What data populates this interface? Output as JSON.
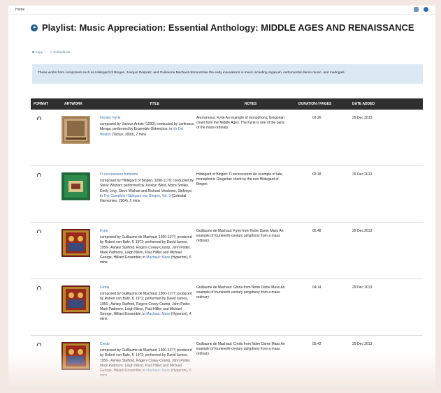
{
  "nav": {
    "home": "Home"
  },
  "page": {
    "title": "Playlist:  Music Appreciation: Essential Anthology: MIDDLE AGES AND RENAISSANCE",
    "copy": "Copy",
    "embed": "Embed/Link",
    "description": "These works from composers such as Hildegard of Bingen, Josquin Desprez, and Guillaume Machaut demonstrate the early innovations in music including organum, instrumental dance music, and madrigals."
  },
  "table": {
    "headers": [
      "FORMAT",
      "ARTWORK",
      "TITLE",
      "NOTES",
      "DURATION / PAGES",
      "DATE ADDED"
    ],
    "rows": [
      {
        "title": "Introito: Kyrie",
        "details": "composed by Various Artists (1200); conducted by Lanfranco Menga; performed by Ensemble Oktoechos; in ",
        "album": "Vir Dei Beatus",
        "tail": " (Tactus, 2000), 2 mins",
        "notes": "Anonymous: Kyrie An example of monophonic Gregorian chant from the Middle Ages. The Kyrie is one of the parts of the mass ordinary.",
        "duration": "02:26",
        "date": "29 Dec 2013"
      },
      {
        "title": "O successores fortissimi",
        "details": "composed by Hildegard of Bingen, 1098-1179; conducted by Steve Wishart; performed by Jocelyn West, Moira Smiley, Emily Levy, Steve Wishart and Richard Vendome, Sinfonye; in ",
        "album": "The Complete Hildegard von Bingen, Vol. 3",
        "tail": " (Celestial Harmonies, 2004), 2 mins",
        "notes": "Hildegard of Bingen: O successores An example of late, monophonic Gregorian chant by the nun Hildegard of Bingen.",
        "duration": "02:18",
        "date": "29 Dec 2013"
      },
      {
        "title": "Kyrie",
        "details": "composed by Guillaume de Machaut, 1300-1377; produced by Robert von Bahr, fl. 1972; performed by David James, 1956-, Ashley Stafford, Rogers Covey-Crump, John Potter, Mark Padmore, Leigh Nixon, Paul Hillier and Michael George, Hilliard Ensemble; in ",
        "album": "Machaut: Mass",
        "tail": " (Hyperion), 6 mins",
        "notes": "Guillaume de Machaut: Kyrie from Notre Dame Mass An example of fourteenth-century polyphony from a mass ordinary.",
        "duration": "05:48",
        "date": "29 Dec 2013"
      },
      {
        "title": "Gloria",
        "details": "composed by Guillaume de Machaut, 1300-1377; produced by Robert von Bahr, fl. 1972; performed by David James, 1956-, Ashley Stafford, Rogers Covey-Crump, John Potter, Mark Padmore, Leigh Nixon, Paul Hillier and Michael George, Hilliard Ensemble; in ",
        "album": "Machaut: Mass",
        "tail": " (Hyperion), 4 mins",
        "notes": "Guillaume de Machaut: Gloria from Notre Dame Mass An example of fourteenth-century polyphony from a mass ordinary.",
        "duration": "04:14",
        "date": "29 Dec 2013"
      },
      {
        "title": "Credo",
        "details": "composed by Guillaume de Machaut, 1300-1377; produced by Robert von Bahr, fl. 1972; performed by David James, 1956-, Ashley Stafford, Rogers Covey-Crump, John Potter, Mark Padmore, Leigh Nixon, Paul Hillier and Michael George, Hilliard Ensemble; in ",
        "album": "Machaut: Mass",
        "tail": " (Hyperion), 6 mins",
        "notes": "Guillaume de Machaut: Credo from Notre Dame Mass An example of fourteenth-century polyphony from a mass ordinary.",
        "duration": "05:42",
        "date": "29 Dec 2013"
      }
    ]
  },
  "colors": {
    "accent": "#1d5a8e",
    "link": "#3d6fa8",
    "header_bg": "#2f2f2f",
    "info_bg": "#dbe9f5"
  },
  "icons": {
    "format": "headphones-icon",
    "play": "play-circle-icon",
    "help": "help-icon",
    "translate": "translate-icon"
  }
}
